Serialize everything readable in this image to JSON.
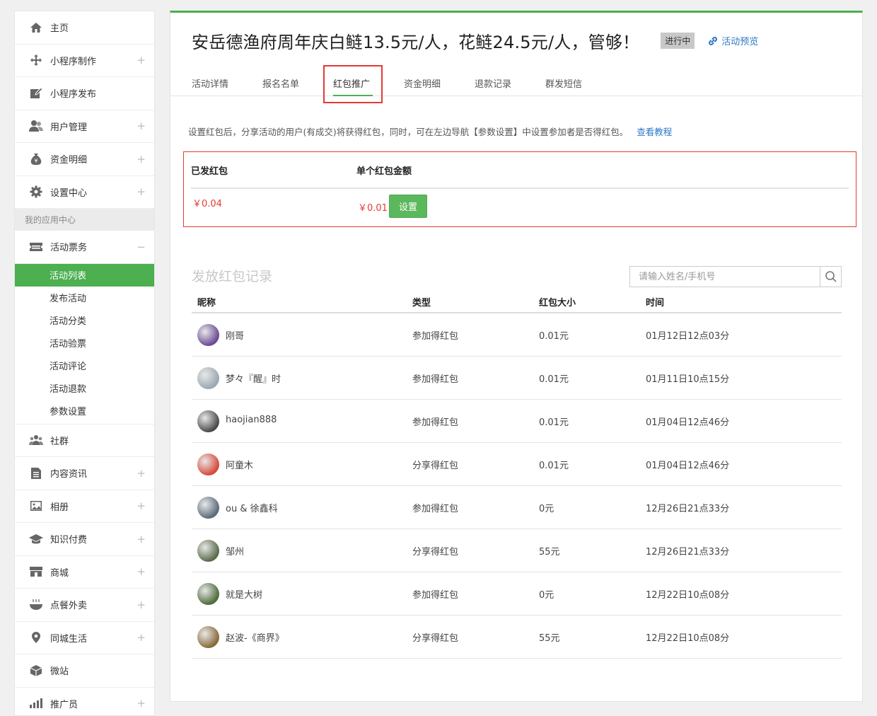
{
  "sidebar": {
    "items_top": [
      {
        "label": "主页",
        "icon": "home-icon",
        "plus": false
      },
      {
        "label": "小程序制作",
        "icon": "move-icon",
        "plus": true
      },
      {
        "label": "小程序发布",
        "icon": "edit-icon",
        "plus": false
      },
      {
        "label": "用户管理",
        "icon": "users-icon",
        "plus": true
      },
      {
        "label": "资金明细",
        "icon": "money-bag-icon",
        "plus": true
      },
      {
        "label": "设置中心",
        "icon": "gear-icon",
        "plus": true
      }
    ],
    "section_label": "我的应用中心",
    "ticket": {
      "label": "活动票务",
      "icon": "ticket-icon",
      "collapse": "−"
    },
    "sub_items": [
      "活动列表",
      "发布活动",
      "活动分类",
      "活动验票",
      "活动评论",
      "活动退款",
      "参数设置"
    ],
    "active_sub": "活动列表",
    "items_bottom": [
      {
        "label": "社群",
        "icon": "group-icon",
        "plus": false
      },
      {
        "label": "内容资讯",
        "icon": "document-icon",
        "plus": true
      },
      {
        "label": "相册",
        "icon": "image-icon",
        "plus": true
      },
      {
        "label": "知识付费",
        "icon": "graduation-cap-icon",
        "plus": true
      },
      {
        "label": "商城",
        "icon": "store-icon",
        "plus": true
      },
      {
        "label": "点餐外卖",
        "icon": "bowl-icon",
        "plus": true
      },
      {
        "label": "同城生活",
        "icon": "map-pin-icon",
        "plus": true
      },
      {
        "label": "微站",
        "icon": "cube-icon",
        "plus": false
      },
      {
        "label": "推广员",
        "icon": "bar-chart-icon",
        "plus": true
      }
    ],
    "plus_symbol": "+"
  },
  "header": {
    "title": "安岳德渔府周年庆白鲢13.5元/人，花鲢24.5元/人，管够！",
    "status": "进行中",
    "preview": "活动预览"
  },
  "tabs": [
    "活动详情",
    "报名名单",
    "红包推广",
    "资金明细",
    "退款记录",
    "群发短信"
  ],
  "active_tab": "红包推广",
  "description": "设置红包后，分享活动的用户(有成交)将获得红包，同时，可在左边导航【参数设置】中设置参加者是否得红包。",
  "tutorial_link": "查看教程",
  "redpacket": {
    "sent_label": "已发红包",
    "amount_label": "单个红包金额",
    "sent_value": "￥0.04",
    "amount_value": "￥0.01",
    "set_button": "设置"
  },
  "records": {
    "title": "发放红包记录",
    "search_placeholder": "请输入姓名/手机号",
    "columns": [
      "昵称",
      "类型",
      "红包大小",
      "时间"
    ],
    "rows": [
      {
        "name": "刚哥",
        "type": "参加得红包",
        "size": "0.01元",
        "time": "01月12日12点03分",
        "avatar": "#6a4c93"
      },
      {
        "name": "梦々『醒』时",
        "type": "参加得红包",
        "size": "0.01元",
        "time": "01月11日10点15分",
        "avatar": "#9aa8b0"
      },
      {
        "name": "haojian888",
        "type": "参加得红包",
        "size": "0.01元",
        "time": "01月04日12点46分",
        "avatar": "#4a4a4a"
      },
      {
        "name": "阿童木",
        "type": "分享得红包",
        "size": "0.01元",
        "time": "01月04日12点46分",
        "avatar": "#d84a3a"
      },
      {
        "name": "ou & 徐鑫科",
        "type": "参加得红包",
        "size": "0元",
        "time": "12月26日21点33分",
        "avatar": "#5c6b7a"
      },
      {
        "name": "邹州",
        "type": "分享得红包",
        "size": "55元",
        "time": "12月26日21点33分",
        "avatar": "#5a6b4a"
      },
      {
        "name": "就是大树",
        "type": "参加得红包",
        "size": "0元",
        "time": "12月22日10点08分",
        "avatar": "#4f6b3a"
      },
      {
        "name": "赵波-《商界》",
        "type": "分享得红包",
        "size": "55元",
        "time": "12月22日10点08分",
        "avatar": "#8a6a3a"
      }
    ]
  },
  "colors": {
    "accent": "#4caf50",
    "red": "#e53935",
    "link": "#2d78c6"
  }
}
